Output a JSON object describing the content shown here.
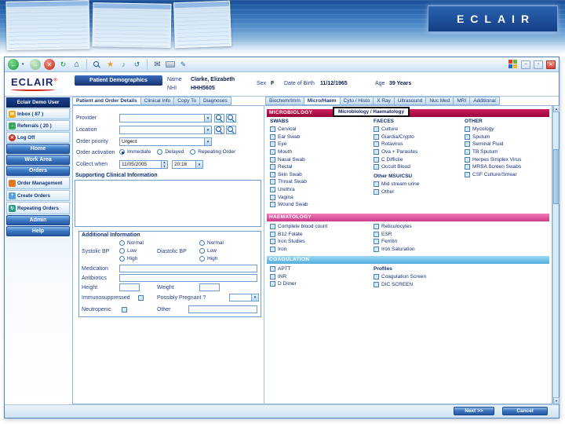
{
  "banner": {
    "logo": "ECLAIR"
  },
  "titlebar": {
    "minimize": "–",
    "maximize": "▫",
    "close": "✕"
  },
  "icons": {
    "back": "←",
    "dropdown": "▾",
    "forward": "→",
    "stop": "✕",
    "refresh": "↻",
    "home": "⌂",
    "favorites": "★",
    "media": "♪",
    "history": "↺",
    "mail": "✉",
    "edit": "✎",
    "up": "▲",
    "down": "▼",
    "plus": "+",
    "registered": "®"
  },
  "patient": {
    "app_logo": "ECLAIR",
    "section_title": "Patient Demographics",
    "name_label": "Name",
    "name": "Clarke, Elizabeth",
    "nhi_label": "NHI",
    "nhi": "HHH5605",
    "sex_label": "Sex",
    "sex": "F",
    "dob_label": "Date of Birth",
    "dob": "11/12/1965",
    "age_label": "Age",
    "age": "39 Years"
  },
  "sidebar": {
    "user": "Eclair Demo User",
    "inbox": "Inbox ( 87 )",
    "referrals": "Referrals ( 20 )",
    "logoff": "Log Off",
    "home": "Home",
    "workarea": "Work Area",
    "orders": "Orders",
    "order_management": "Order Management",
    "create_orders": "Create Orders",
    "repeating_orders": "Repeating Orders",
    "admin": "Admin",
    "help": "Help"
  },
  "tabs_left": [
    "Patient and Order Details",
    "Clinical Info",
    "Copy To",
    "Diagnoses"
  ],
  "tabs_right": [
    "Biochem/Imm",
    "Micro/Haem",
    "Cyto / Histo",
    "X Ray",
    "Ultrasound",
    "Nuc Med",
    "MRI",
    "Additional"
  ],
  "form": {
    "provider_label": "Provider",
    "location_label": "Location",
    "priority_label": "Order priority",
    "priority_value": "Urgent",
    "activation_label": "Order activation",
    "activation_options": [
      "Immediate",
      "Delayed",
      "Repeating Order"
    ],
    "collect_label": "Collect when",
    "collect_date": "11/05/2005",
    "collect_time": "20:16",
    "supporting_title": "Supporting Clinical Information",
    "additional": {
      "title": "Additional Information",
      "systolic_label": "Systolic BP",
      "diastolic_label": "Diastolic BP",
      "bp_normal": "Normal",
      "bp_low": "Low",
      "bp_high": "High",
      "medication_label": "Medication",
      "antibiotics_label": "Antibiotics",
      "height_label": "Height",
      "weight_label": "Weight",
      "immuno_label": "Immunosuppressed",
      "pregnant_label": "Possibly Pregnant ?",
      "neutropenic_label": "Neutropenic",
      "other_label": "Other"
    }
  },
  "orders": {
    "micro_title": "MICROBIOLOGY",
    "micro_tab": "Microbiology / Haematology",
    "swabs_title": "SWABS",
    "swabs": [
      "Cervical",
      "Ear Swab",
      "Eye",
      "Mouth",
      "Nasal Swab",
      "Rectal",
      "Skin Swab",
      "Throat Swab",
      "Urethra",
      "Vagina",
      "Wound Swab"
    ],
    "faeces_title": "FAECES",
    "faeces": [
      "Culture",
      "Giardia/Crypto",
      "Rotavirus",
      "Ova + Parasites",
      "C Difficile",
      "Occult Blood"
    ],
    "urine_title": "Other MSU/CSU",
    "urine": [
      "Mid stream urine",
      "Other"
    ],
    "other_title": "OTHER",
    "other": [
      "Mycology",
      "Sputum",
      "Seminal Fluid",
      "TB Sputum",
      "Herpes Simplex Virus",
      "MRSA Screen Swabs",
      "CSF Culture/Smear"
    ],
    "haem_title": "HAEMATOLOGY",
    "haem_col1": [
      "Complete blood count",
      "B12 Folate",
      "Iron Studies",
      "Iron"
    ],
    "haem_col2": [
      "Reticulocytes",
      "ESR",
      "Ferritin",
      "Iron Saturation"
    ],
    "coag_title": "COAGULATION",
    "coag_col1": [
      "APTT",
      "INR",
      "D Dimer"
    ],
    "profiles_label": "Profiles",
    "coag_col2": [
      "Coagulation Screen",
      "DIC SCREEN"
    ]
  },
  "footer": {
    "next": "Next >>",
    "cancel": "Cancel"
  },
  "colors": {
    "micro": "#b00a44",
    "haem": "#e0559d",
    "coag": "#74c6e8",
    "accent": "#1c55a4"
  }
}
